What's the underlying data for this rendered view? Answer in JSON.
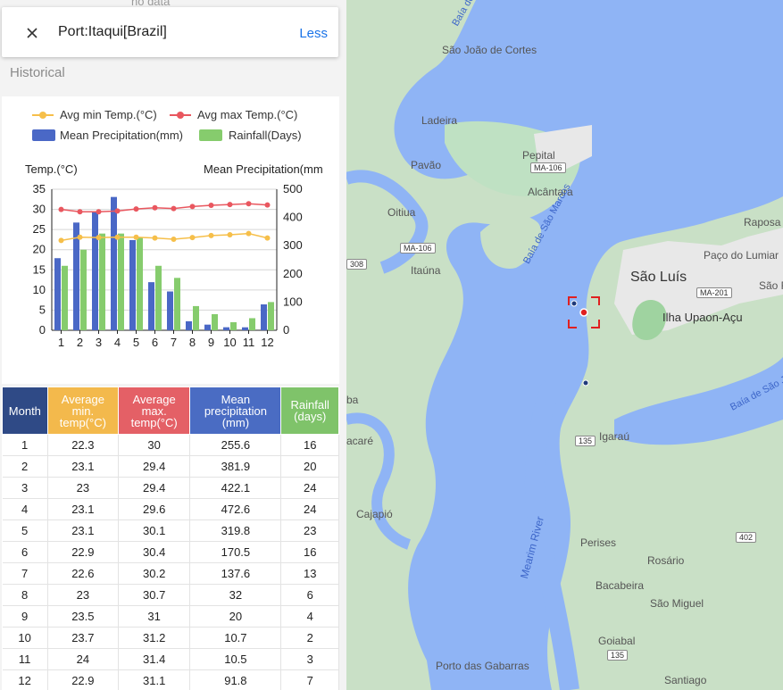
{
  "header": {
    "port_title": "Port:Itaqui[Brazil]",
    "less_label": "Less",
    "ghost_text": "no data"
  },
  "section": {
    "historical_label": "Historical"
  },
  "chart_data": {
    "type": "bar+line",
    "legend": [
      {
        "name": "Avg min Temp.(°C)",
        "color": "#f6bf4a",
        "kind": "line"
      },
      {
        "name": "Avg max Temp.(°C)",
        "color": "#e9575f",
        "kind": "line"
      },
      {
        "name": "Mean Precipitation(mm)",
        "color": "#4a68c6",
        "kind": "bar"
      },
      {
        "name": "Rainfall(Days)",
        "color": "#86cc6d",
        "kind": "bar"
      }
    ],
    "left_axis_label": "Temp.(°C)",
    "right_axis_label": "Mean Precipitation(mm",
    "categories": [
      "1",
      "2",
      "3",
      "4",
      "5",
      "6",
      "7",
      "8",
      "9",
      "10",
      "11",
      "12"
    ],
    "left_ylim": [
      0,
      35
    ],
    "left_ticks": [
      "0",
      "5",
      "10",
      "15",
      "20",
      "25",
      "30",
      "35"
    ],
    "right_ylim": [
      0,
      500
    ],
    "right_ticks": [
      "0",
      "100",
      "200",
      "300",
      "400",
      "500"
    ],
    "series": {
      "min_temp": [
        22.3,
        23.1,
        23,
        23.1,
        23.1,
        22.9,
        22.6,
        23,
        23.5,
        23.7,
        24,
        22.9
      ],
      "max_temp": [
        30,
        29.4,
        29.4,
        29.6,
        30.1,
        30.4,
        30.2,
        30.7,
        31,
        31.2,
        31.4,
        31.1
      ],
      "precipitation": [
        255.6,
        381.9,
        422.1,
        472.6,
        319.8,
        170.5,
        137.6,
        32,
        20,
        10.7,
        10.5,
        91.8
      ],
      "rainfall_days": [
        16,
        20,
        24,
        24,
        23,
        16,
        13,
        6,
        4,
        2,
        3,
        7
      ]
    }
  },
  "table": {
    "headers": {
      "month": "Month",
      "min": "Average min. temp(°C)",
      "max": "Average max. temp(°C)",
      "precip": "Mean precipitation (mm)",
      "rain": "Rainfall (days)"
    },
    "rows": [
      [
        "1",
        "22.3",
        "30",
        "255.6",
        "16"
      ],
      [
        "2",
        "23.1",
        "29.4",
        "381.9",
        "20"
      ],
      [
        "3",
        "23",
        "29.4",
        "422.1",
        "24"
      ],
      [
        "4",
        "23.1",
        "29.6",
        "472.6",
        "24"
      ],
      [
        "5",
        "23.1",
        "30.1",
        "319.8",
        "23"
      ],
      [
        "6",
        "22.9",
        "30.4",
        "170.5",
        "16"
      ],
      [
        "7",
        "22.6",
        "30.2",
        "137.6",
        "13"
      ],
      [
        "8",
        "23",
        "30.7",
        "32",
        "6"
      ],
      [
        "9",
        "23.5",
        "31",
        "20",
        "4"
      ],
      [
        "10",
        "23.7",
        "31.2",
        "10.7",
        "2"
      ],
      [
        "11",
        "24",
        "31.4",
        "10.5",
        "3"
      ],
      [
        "12",
        "22.9",
        "31.1",
        "91.8",
        "7"
      ]
    ]
  },
  "map": {
    "labels": {
      "baia_top": "Baía de",
      "sao_joao": "São João de Cortes",
      "ladeira": "Ladeira",
      "pavao": "Pavão",
      "pepital": "Pepital",
      "alcantara": "Alcântara",
      "oitiua": "Oitiua",
      "itauna": "Itaúna",
      "raposa": "Raposa",
      "paco": "Paço do Lumiar",
      "sao_luis": "São Luís",
      "sao_rib": "São Rib",
      "ilha": "Ilha Upaon-Açu",
      "baia_sao_marcos": "Baía de São Marcos",
      "baia_sao_jo": "Baía de São Jo",
      "ba": "ba",
      "acare": "acaré",
      "igarau": "Igaraú",
      "cajapio": "Cajapió",
      "mearim": "Mearim River",
      "perises": "Perises",
      "rosario": "Rosário",
      "bacabeira": "Bacabeira",
      "sao_miguel": "São Miguel",
      "goiabal": "Goiabal",
      "porto_das_gabarras": "Porto das Gabarras",
      "santiago": "Santiago"
    },
    "shields": {
      "ma106a": "MA-106",
      "ma106b": "MA-106",
      "r308": "308",
      "ma201": "MA-201",
      "r135a": "135",
      "r135b": "135",
      "r402": "402"
    }
  }
}
